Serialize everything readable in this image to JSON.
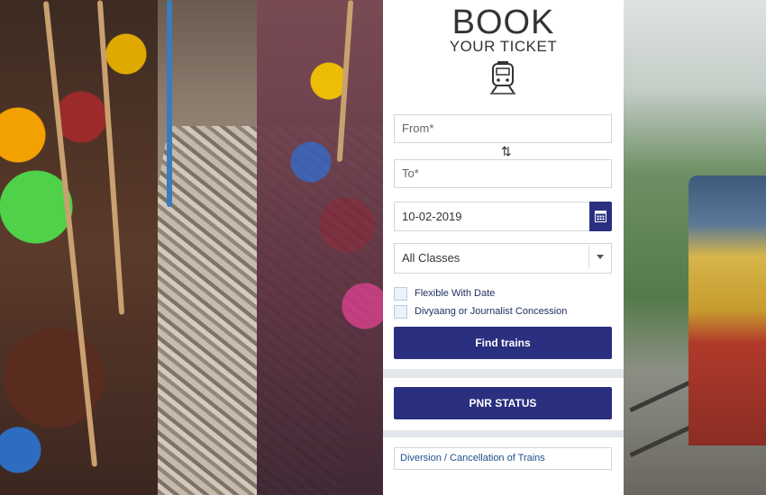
{
  "widget": {
    "title": "BOOK",
    "subtitle": "YOUR TICKET",
    "from_placeholder": "From*",
    "to_placeholder": "To*",
    "date_value": "10-02-2019",
    "class_selected": "All Classes",
    "flexible_label": "Flexible With Date",
    "concession_label": "Divyaang or Journalist Concession",
    "find_button": "Find trains",
    "pnr_button": "PNR STATUS",
    "diversion_link": "Diversion / Cancellation of Trains"
  },
  "icons": {
    "logo": "train-icon",
    "swap": "swap-icon",
    "calendar": "calendar-icon",
    "dropdown": "chevron-down-icon"
  },
  "colors": {
    "accent": "#2b2f7f",
    "border": "#cfd6de",
    "link": "#1f4f8a"
  }
}
